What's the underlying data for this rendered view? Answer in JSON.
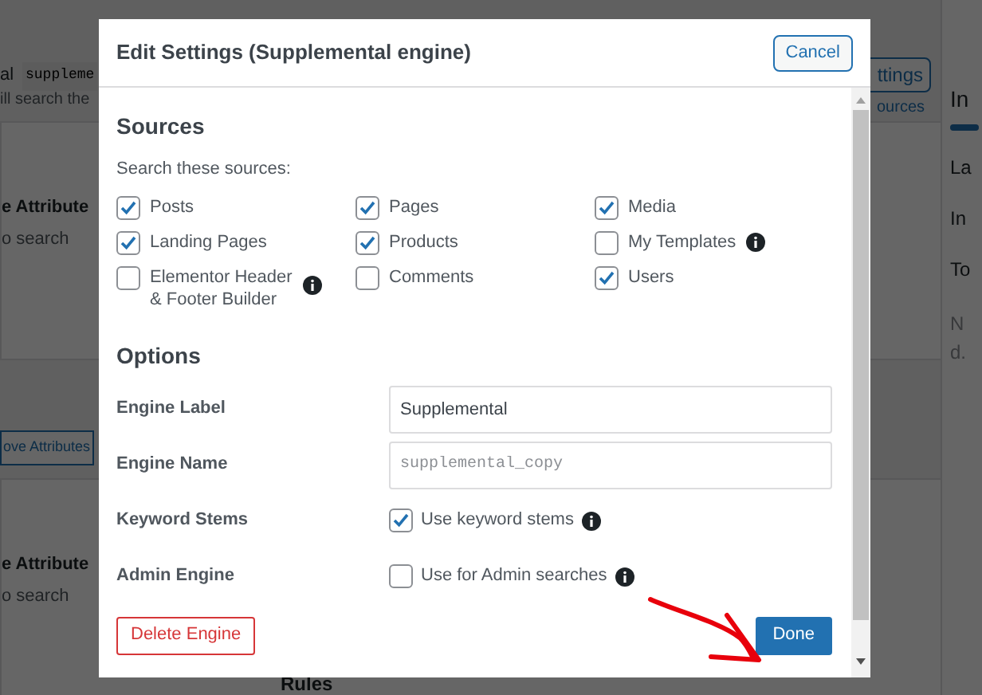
{
  "background": {
    "header_label": "al",
    "code_field": "suppleme",
    "settings_button": "ttings",
    "intro_text": "ill search the",
    "sources_link": "ources",
    "cards": [
      {
        "title": "e Attribute",
        "subtitle": "o search"
      },
      {
        "title": "e Attribute",
        "subtitle": "o search"
      }
    ],
    "remove_button": "ove Attributes",
    "rules_label": "Rules",
    "sidebar": {
      "heading": "In",
      "progress": {
        "level": 1
      },
      "items": [
        "La",
        "In",
        "To"
      ],
      "note": [
        "N",
        "d."
      ]
    }
  },
  "modal": {
    "title": "Edit Settings (Supplemental engine)",
    "cancel": "Cancel",
    "sources": {
      "heading": "Sources",
      "prompt": "Search these sources:",
      "items": [
        {
          "label": "Posts",
          "checked": true,
          "info": false
        },
        {
          "label": "Pages",
          "checked": true,
          "info": false
        },
        {
          "label": "Media",
          "checked": true,
          "info": false
        },
        {
          "label": "Landing Pages",
          "checked": true,
          "info": false
        },
        {
          "label": "Products",
          "checked": true,
          "info": false
        },
        {
          "label": "My Templates",
          "checked": false,
          "info": true
        },
        {
          "label": "Elementor Header & Footer Builder",
          "checked": false,
          "info": true
        },
        {
          "label": "Comments",
          "checked": false,
          "info": false
        },
        {
          "label": "Users",
          "checked": true,
          "info": false
        }
      ]
    },
    "options": {
      "heading": "Options",
      "rows": [
        {
          "kind": "text",
          "label": "Engine Label",
          "value": "Supplemental"
        },
        {
          "kind": "readonly",
          "label": "Engine Name",
          "value": "supplemental_copy"
        },
        {
          "kind": "checkbox",
          "label": "Keyword Stems",
          "text": "Use keyword stems",
          "checked": true
        },
        {
          "kind": "checkbox",
          "label": "Admin Engine",
          "text": "Use for Admin searches",
          "checked": false
        }
      ]
    },
    "delete_button": "Delete Engine",
    "done_button": "Done"
  }
}
